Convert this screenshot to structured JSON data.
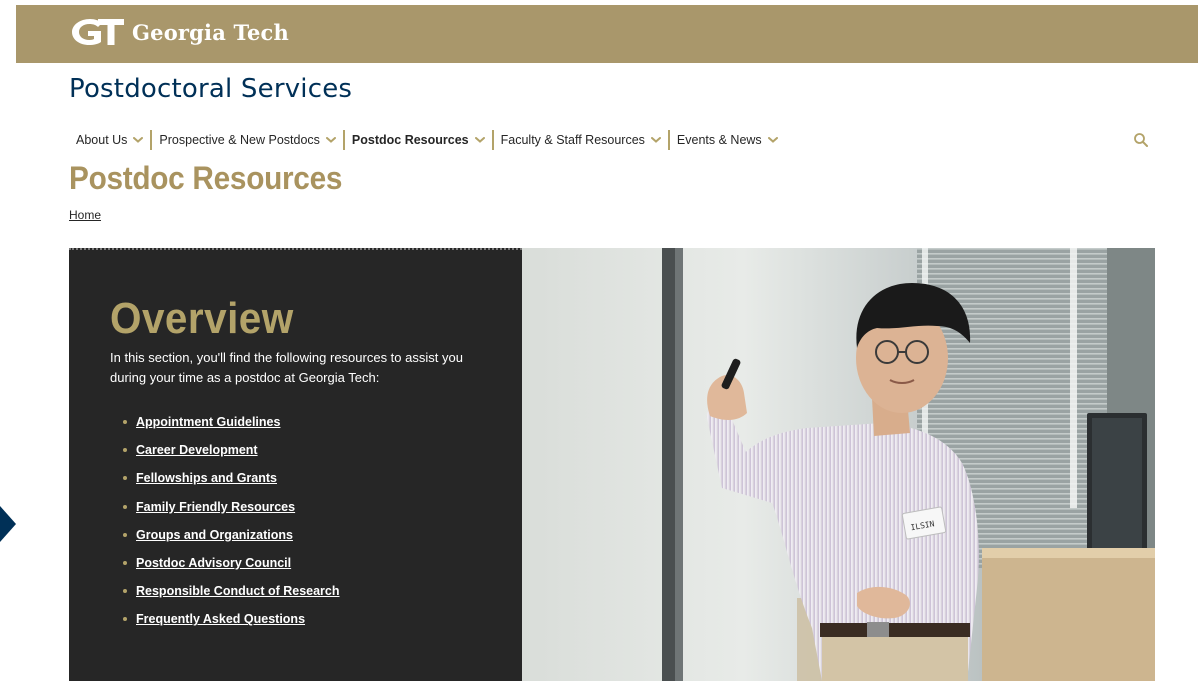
{
  "brand": {
    "logo_mark": "GT",
    "name": "Georgia Tech",
    "colors": {
      "gold": "#a9976b",
      "gold_accent": "#b3a369",
      "navy": "#003057",
      "dark_panel": "#262626"
    }
  },
  "site": {
    "title": "Postdoctoral Services"
  },
  "nav": {
    "items": [
      {
        "label": "About Us",
        "icon": "chevron-down-icon"
      },
      {
        "label": "Prospective & New Postdocs",
        "icon": "chevron-down-icon"
      },
      {
        "label": "Postdoc Resources",
        "icon": "chevron-down-icon",
        "active": true
      },
      {
        "label": "Faculty & Staff Resources",
        "icon": "chevron-down-icon"
      },
      {
        "label": "Events & News",
        "icon": "chevron-down-icon"
      }
    ],
    "search_icon": "search-icon"
  },
  "page": {
    "title": "Postdoc Resources",
    "breadcrumb": "Home"
  },
  "hero": {
    "heading": "Overview",
    "intro": "In this section, you'll find the following resources to assist you during your time as a postdoc at Georgia Tech:",
    "links": [
      "Appointment Guidelines",
      "Career Development",
      "Fellowships and Grants",
      "Family Friendly Resources",
      "Groups and Organizations",
      "Postdoc Advisory Council",
      "Responsible Conduct of Research",
      "Frequently Asked Questions"
    ],
    "photo": {
      "name_tag": "ILSIN"
    }
  },
  "side_arrow": {
    "icon": "arrow-right-icon"
  }
}
